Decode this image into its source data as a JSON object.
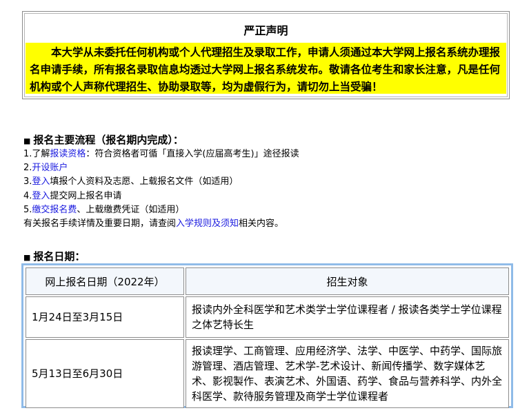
{
  "notice": {
    "title": "严正声明",
    "body": "本大学从未委托任何机构或个人代理招生及录取工作，申请人须通过本大学网上报名系统办理报名申请手续，所有报名录取信息均透过大学网上报名系统发布。敬请各位考生和家长注意，凡是任何机构或个人声称代理招生、协助录取等，均为虚假行为，请切勿上当受骗！"
  },
  "process": {
    "bullet": "■",
    "title": "报名主要流程（报名期内完成）：",
    "step1": {
      "prefix": "1.了解",
      "link": "报读资格",
      "suffix": "：符合资格者可循「直接入学(应届高考生)」途径报读"
    },
    "step2": {
      "prefix": "2.",
      "link": "开设账户"
    },
    "step3": {
      "prefix": "3.",
      "link": "登入",
      "suffix": "填报个人资料及志愿、上载报名文件（如适用）"
    },
    "step4": {
      "prefix": "4.",
      "link": "登入",
      "suffix": "提交网上报名申请"
    },
    "step5": {
      "prefix": "5.",
      "link": "缴交报名费",
      "suffix": "、上载缴费凭证（如适用）"
    },
    "note": {
      "prefix": "有关报名手续详情及重要日期，请查阅",
      "link": "入学规则及须知",
      "suffix": "相关内容。"
    }
  },
  "dates": {
    "bullet": "■",
    "title": "报名日期：",
    "headers": [
      "网上报名日期（2022年）",
      "招生对象"
    ],
    "rows": [
      [
        "1月24日至3月15日",
        "报读内外全科医学和艺术类学士学位课程者 / 报读各类学士学位课程之体艺特长生"
      ],
      [
        "5月13日至6月30日",
        "报读理学、工商管理、应用经济学、法学、中医学、中药学、国际旅游管理、酒店管理、艺术学-艺术设计、新闻传播学、数字媒体艺术、影视製作、表演艺术、外国语、药学、食品与营养科学、内外全科医学、款待服务管理及商学士学位课程者"
      ]
    ]
  },
  "colors": {
    "notice_bg": "#ffff00",
    "link": "#1a1adf",
    "table_border": "#8fbbe8",
    "header_bg": "#f3f7fc"
  }
}
